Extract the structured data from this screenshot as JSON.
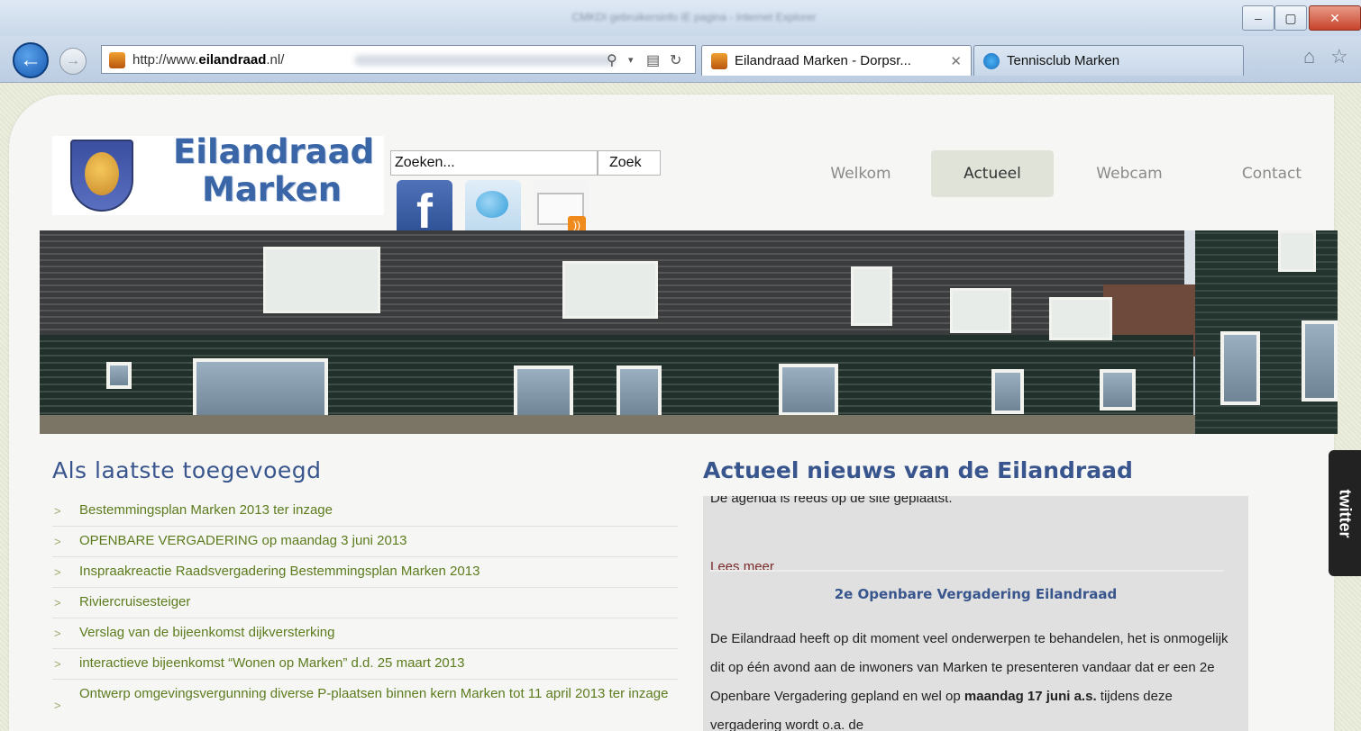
{
  "browser": {
    "window_title_blurred": "CMKDI gebruikersinfo IE pagina - Internet Explorer",
    "controls": {
      "min": "–",
      "max": "▢",
      "close": "✕"
    },
    "back_icon": "←",
    "forward_icon": "→",
    "address": {
      "prefix": "http://www.",
      "domain": "eilandraad",
      "suffix": ".nl/"
    },
    "address_icons": {
      "search": "⚲",
      "dropdown": "▾",
      "compat": "▤",
      "refresh": "↻"
    },
    "tabs": [
      {
        "label": "Eilandraad Marken - Dorpsr...",
        "close": "✕"
      },
      {
        "label": "Tennisclub Marken"
      }
    ],
    "home_icon": "⌂",
    "favorites_icon": "☆"
  },
  "site": {
    "logo": {
      "line1": "Eilandraad",
      "line2": "Marken"
    },
    "search": {
      "placeholder": "Zoeken...",
      "value": "Zoeken...",
      "button": "Zoek"
    },
    "social": {
      "facebook_glyph": "f",
      "rss_badge": "))"
    },
    "nav": [
      "Welkom",
      "Actueel",
      "Webcam",
      "Contact"
    ],
    "active_nav": "Actueel",
    "left": {
      "heading": "Als laatste toegevoegd",
      "bullet": ">",
      "items": [
        "Bestemmingsplan Marken 2013 ter inzage",
        "OPENBARE VERGADERING op maandag 3 juni 2013",
        "Inspraakreactie Raadsvergadering Bestemmingsplan Marken 2013",
        "Riviercruisesteiger",
        "Verslag van de bijeenkomst dijkversterking",
        "interactieve bijeenkomst “Wonen op Marken” d.d. 25 maart 2013",
        "Ontwerp omgevingsvergunning diverse P-plaatsen binnen kern Marken tot 11 april 2013 ter inzage"
      ]
    },
    "right": {
      "heading": "Actueel nieuws van de Eilandraad",
      "cut_line": "De agenda is reeds op de site geplaatst.",
      "read_more": "Lees meer",
      "article_title": "2e Openbare Vergadering Eilandraad",
      "article_body_pre": "De Eilandraad heeft op dit moment veel onderwerpen te behandelen, het is onmogelijk dit op één avond aan de inwoners van Marken te presenteren vandaar dat er een 2e Openbare Vergadering gepland en wel op ",
      "article_body_bold": "maandag 17 juni a.s.",
      "article_body_post": " tijdens deze vergadering wordt o.a. de"
    },
    "twitter_tab": "twitter"
  }
}
